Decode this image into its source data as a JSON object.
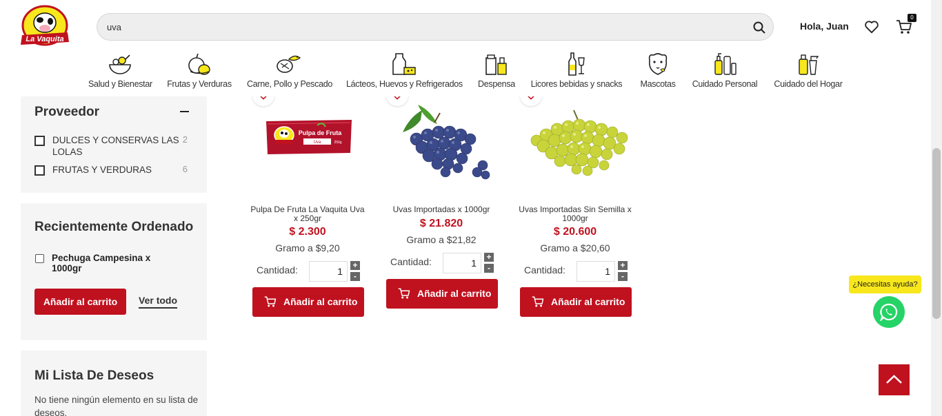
{
  "brand": {
    "logo_text": "La Vaquita",
    "accent": "#c0111f"
  },
  "search": {
    "value": "uva",
    "icon": "search-icon"
  },
  "header": {
    "greeting": "Hola, Juan",
    "wishlist_icon": "heart-icon",
    "cart_icon": "cart-icon",
    "cart_count": "0"
  },
  "categories": [
    {
      "label": "Salud y Bienestar",
      "icon": "salad-bowl-icon"
    },
    {
      "label": "Frutas y Verduras",
      "icon": "fruits-icon"
    },
    {
      "label": "Carne, Pollo y Pescado",
      "icon": "meat-fish-icon"
    },
    {
      "label": "Lácteos, Huevos y Refrigerados",
      "icon": "milk-cheese-icon"
    },
    {
      "label": "Despensa",
      "icon": "pantry-icon"
    },
    {
      "label": "Licores bebidas y snacks",
      "icon": "bottle-glass-icon"
    },
    {
      "label": "Mascotas",
      "icon": "pet-icon"
    },
    {
      "label": "Cuidado Personal",
      "icon": "personal-care-icon"
    },
    {
      "label": "Cuidado del Hogar",
      "icon": "cleaning-icon"
    }
  ],
  "filters": {
    "provider": {
      "title": "Proveedor",
      "items": [
        {
          "label": "DULCES Y CONSERVAS LAS LOLAS",
          "count": "2"
        },
        {
          "label": "FRUTAS Y VERDURAS",
          "count": "6"
        }
      ]
    }
  },
  "recent": {
    "title": "Recientemente Ordenado",
    "item": "Pechuga Campesina x 1000gr",
    "add_label": "Añadir al carrito",
    "view_all": "Ver todo"
  },
  "wishlist": {
    "title": "Mi Lista De Deseos",
    "empty_text": "No tiene ningún elemento en su lista de deseos."
  },
  "products": [
    {
      "name": "Pulpa De Fruta La Vaquita Uva x 250gr",
      "price": "$ 2.300",
      "unit_price": "Gramo a $9,20",
      "qty_label": "Cantidad:",
      "qty": "1",
      "cta": "Añadir al carrito",
      "pack_label": "Pulpa de Fruta",
      "pack_flavor": "Uva",
      "pack_weight": "250g"
    },
    {
      "name": "Uvas Importadas x 1000gr",
      "price": "$ 21.820",
      "unit_price": "Gramo a $21,82",
      "qty_label": "Cantidad:",
      "qty": "1",
      "cta": "Añadir al carrito"
    },
    {
      "name": "Uvas Importadas Sin Semilla x 1000gr",
      "price": "$ 20.600",
      "unit_price": "Gramo a $20,60",
      "qty_label": "Cantidad:",
      "qty": "1",
      "cta": "Añadir al carrito"
    }
  ],
  "help": {
    "bubble": "¿Necesitas ayuda?",
    "icon": "whatsapp-icon"
  },
  "back_to_top": {
    "icon": "chevron-up-icon"
  }
}
